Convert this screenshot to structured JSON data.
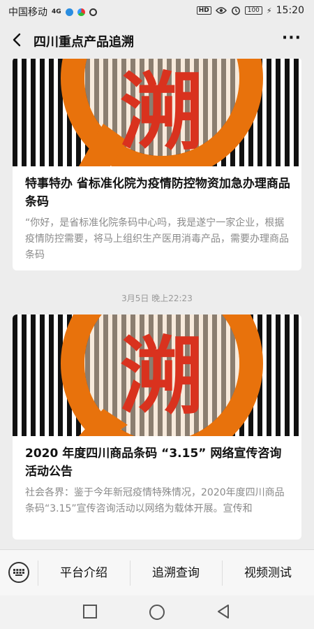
{
  "status_bar": {
    "carrier": "中国移动",
    "network": "4G",
    "time": "15:20",
    "battery": "100",
    "hd": "HD"
  },
  "header": {
    "title": "四川重点产品追溯",
    "back_icon": "chevron-left-icon",
    "more_icon": "more-dots-icon"
  },
  "feed": {
    "articles": [
      {
        "cover_char": "溯",
        "title": "特事特办 省标准化院为疫情防控物资加急办理商品条码",
        "summary": "“你好，是省标准化院条码中心吗，我是遂宁一家企业，根据疫情防控需要，将马上组织生产医用消毒产品，需要办理商品条码"
      },
      {
        "cover_char": "溯",
        "title": "2020 年度四川商品条码 “3.15” 网络宣传咨询活动公告",
        "summary": "社会各界：鉴于今年新冠疫情特殊情况，2020年度四川商品条码“3.15”宣传咨询活动以网络为载体开展。宣传和"
      }
    ],
    "timestamp": "3月5日 晚上22:23"
  },
  "menu": {
    "items": [
      "平台介绍",
      "追溯查询",
      "视频测试"
    ]
  },
  "colors": {
    "accent_orange": "#e8720c",
    "accent_red": "#d9321e",
    "background": "#ededed"
  }
}
